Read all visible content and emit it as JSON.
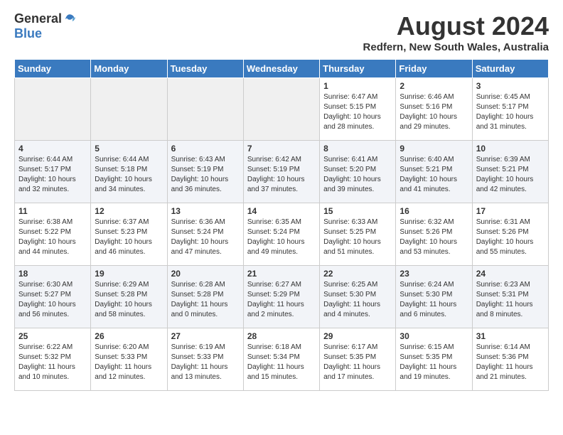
{
  "logo": {
    "general": "General",
    "blue": "Blue"
  },
  "title": {
    "month_year": "August 2024",
    "location": "Redfern, New South Wales, Australia"
  },
  "days_of_week": [
    "Sunday",
    "Monday",
    "Tuesday",
    "Wednesday",
    "Thursday",
    "Friday",
    "Saturday"
  ],
  "weeks": [
    [
      {
        "day": "",
        "content": ""
      },
      {
        "day": "",
        "content": ""
      },
      {
        "day": "",
        "content": ""
      },
      {
        "day": "",
        "content": ""
      },
      {
        "day": "1",
        "content": "Sunrise: 6:47 AM\nSunset: 5:15 PM\nDaylight: 10 hours and 28 minutes."
      },
      {
        "day": "2",
        "content": "Sunrise: 6:46 AM\nSunset: 5:16 PM\nDaylight: 10 hours and 29 minutes."
      },
      {
        "day": "3",
        "content": "Sunrise: 6:45 AM\nSunset: 5:17 PM\nDaylight: 10 hours and 31 minutes."
      }
    ],
    [
      {
        "day": "4",
        "content": "Sunrise: 6:44 AM\nSunset: 5:17 PM\nDaylight: 10 hours and 32 minutes."
      },
      {
        "day": "5",
        "content": "Sunrise: 6:44 AM\nSunset: 5:18 PM\nDaylight: 10 hours and 34 minutes."
      },
      {
        "day": "6",
        "content": "Sunrise: 6:43 AM\nSunset: 5:19 PM\nDaylight: 10 hours and 36 minutes."
      },
      {
        "day": "7",
        "content": "Sunrise: 6:42 AM\nSunset: 5:19 PM\nDaylight: 10 hours and 37 minutes."
      },
      {
        "day": "8",
        "content": "Sunrise: 6:41 AM\nSunset: 5:20 PM\nDaylight: 10 hours and 39 minutes."
      },
      {
        "day": "9",
        "content": "Sunrise: 6:40 AM\nSunset: 5:21 PM\nDaylight: 10 hours and 41 minutes."
      },
      {
        "day": "10",
        "content": "Sunrise: 6:39 AM\nSunset: 5:21 PM\nDaylight: 10 hours and 42 minutes."
      }
    ],
    [
      {
        "day": "11",
        "content": "Sunrise: 6:38 AM\nSunset: 5:22 PM\nDaylight: 10 hours and 44 minutes."
      },
      {
        "day": "12",
        "content": "Sunrise: 6:37 AM\nSunset: 5:23 PM\nDaylight: 10 hours and 46 minutes."
      },
      {
        "day": "13",
        "content": "Sunrise: 6:36 AM\nSunset: 5:24 PM\nDaylight: 10 hours and 47 minutes."
      },
      {
        "day": "14",
        "content": "Sunrise: 6:35 AM\nSunset: 5:24 PM\nDaylight: 10 hours and 49 minutes."
      },
      {
        "day": "15",
        "content": "Sunrise: 6:33 AM\nSunset: 5:25 PM\nDaylight: 10 hours and 51 minutes."
      },
      {
        "day": "16",
        "content": "Sunrise: 6:32 AM\nSunset: 5:26 PM\nDaylight: 10 hours and 53 minutes."
      },
      {
        "day": "17",
        "content": "Sunrise: 6:31 AM\nSunset: 5:26 PM\nDaylight: 10 hours and 55 minutes."
      }
    ],
    [
      {
        "day": "18",
        "content": "Sunrise: 6:30 AM\nSunset: 5:27 PM\nDaylight: 10 hours and 56 minutes."
      },
      {
        "day": "19",
        "content": "Sunrise: 6:29 AM\nSunset: 5:28 PM\nDaylight: 10 hours and 58 minutes."
      },
      {
        "day": "20",
        "content": "Sunrise: 6:28 AM\nSunset: 5:28 PM\nDaylight: 11 hours and 0 minutes."
      },
      {
        "day": "21",
        "content": "Sunrise: 6:27 AM\nSunset: 5:29 PM\nDaylight: 11 hours and 2 minutes."
      },
      {
        "day": "22",
        "content": "Sunrise: 6:25 AM\nSunset: 5:30 PM\nDaylight: 11 hours and 4 minutes."
      },
      {
        "day": "23",
        "content": "Sunrise: 6:24 AM\nSunset: 5:30 PM\nDaylight: 11 hours and 6 minutes."
      },
      {
        "day": "24",
        "content": "Sunrise: 6:23 AM\nSunset: 5:31 PM\nDaylight: 11 hours and 8 minutes."
      }
    ],
    [
      {
        "day": "25",
        "content": "Sunrise: 6:22 AM\nSunset: 5:32 PM\nDaylight: 11 hours and 10 minutes."
      },
      {
        "day": "26",
        "content": "Sunrise: 6:20 AM\nSunset: 5:33 PM\nDaylight: 11 hours and 12 minutes."
      },
      {
        "day": "27",
        "content": "Sunrise: 6:19 AM\nSunset: 5:33 PM\nDaylight: 11 hours and 13 minutes."
      },
      {
        "day": "28",
        "content": "Sunrise: 6:18 AM\nSunset: 5:34 PM\nDaylight: 11 hours and 15 minutes."
      },
      {
        "day": "29",
        "content": "Sunrise: 6:17 AM\nSunset: 5:35 PM\nDaylight: 11 hours and 17 minutes."
      },
      {
        "day": "30",
        "content": "Sunrise: 6:15 AM\nSunset: 5:35 PM\nDaylight: 11 hours and 19 minutes."
      },
      {
        "day": "31",
        "content": "Sunrise: 6:14 AM\nSunset: 5:36 PM\nDaylight: 11 hours and 21 minutes."
      }
    ]
  ]
}
